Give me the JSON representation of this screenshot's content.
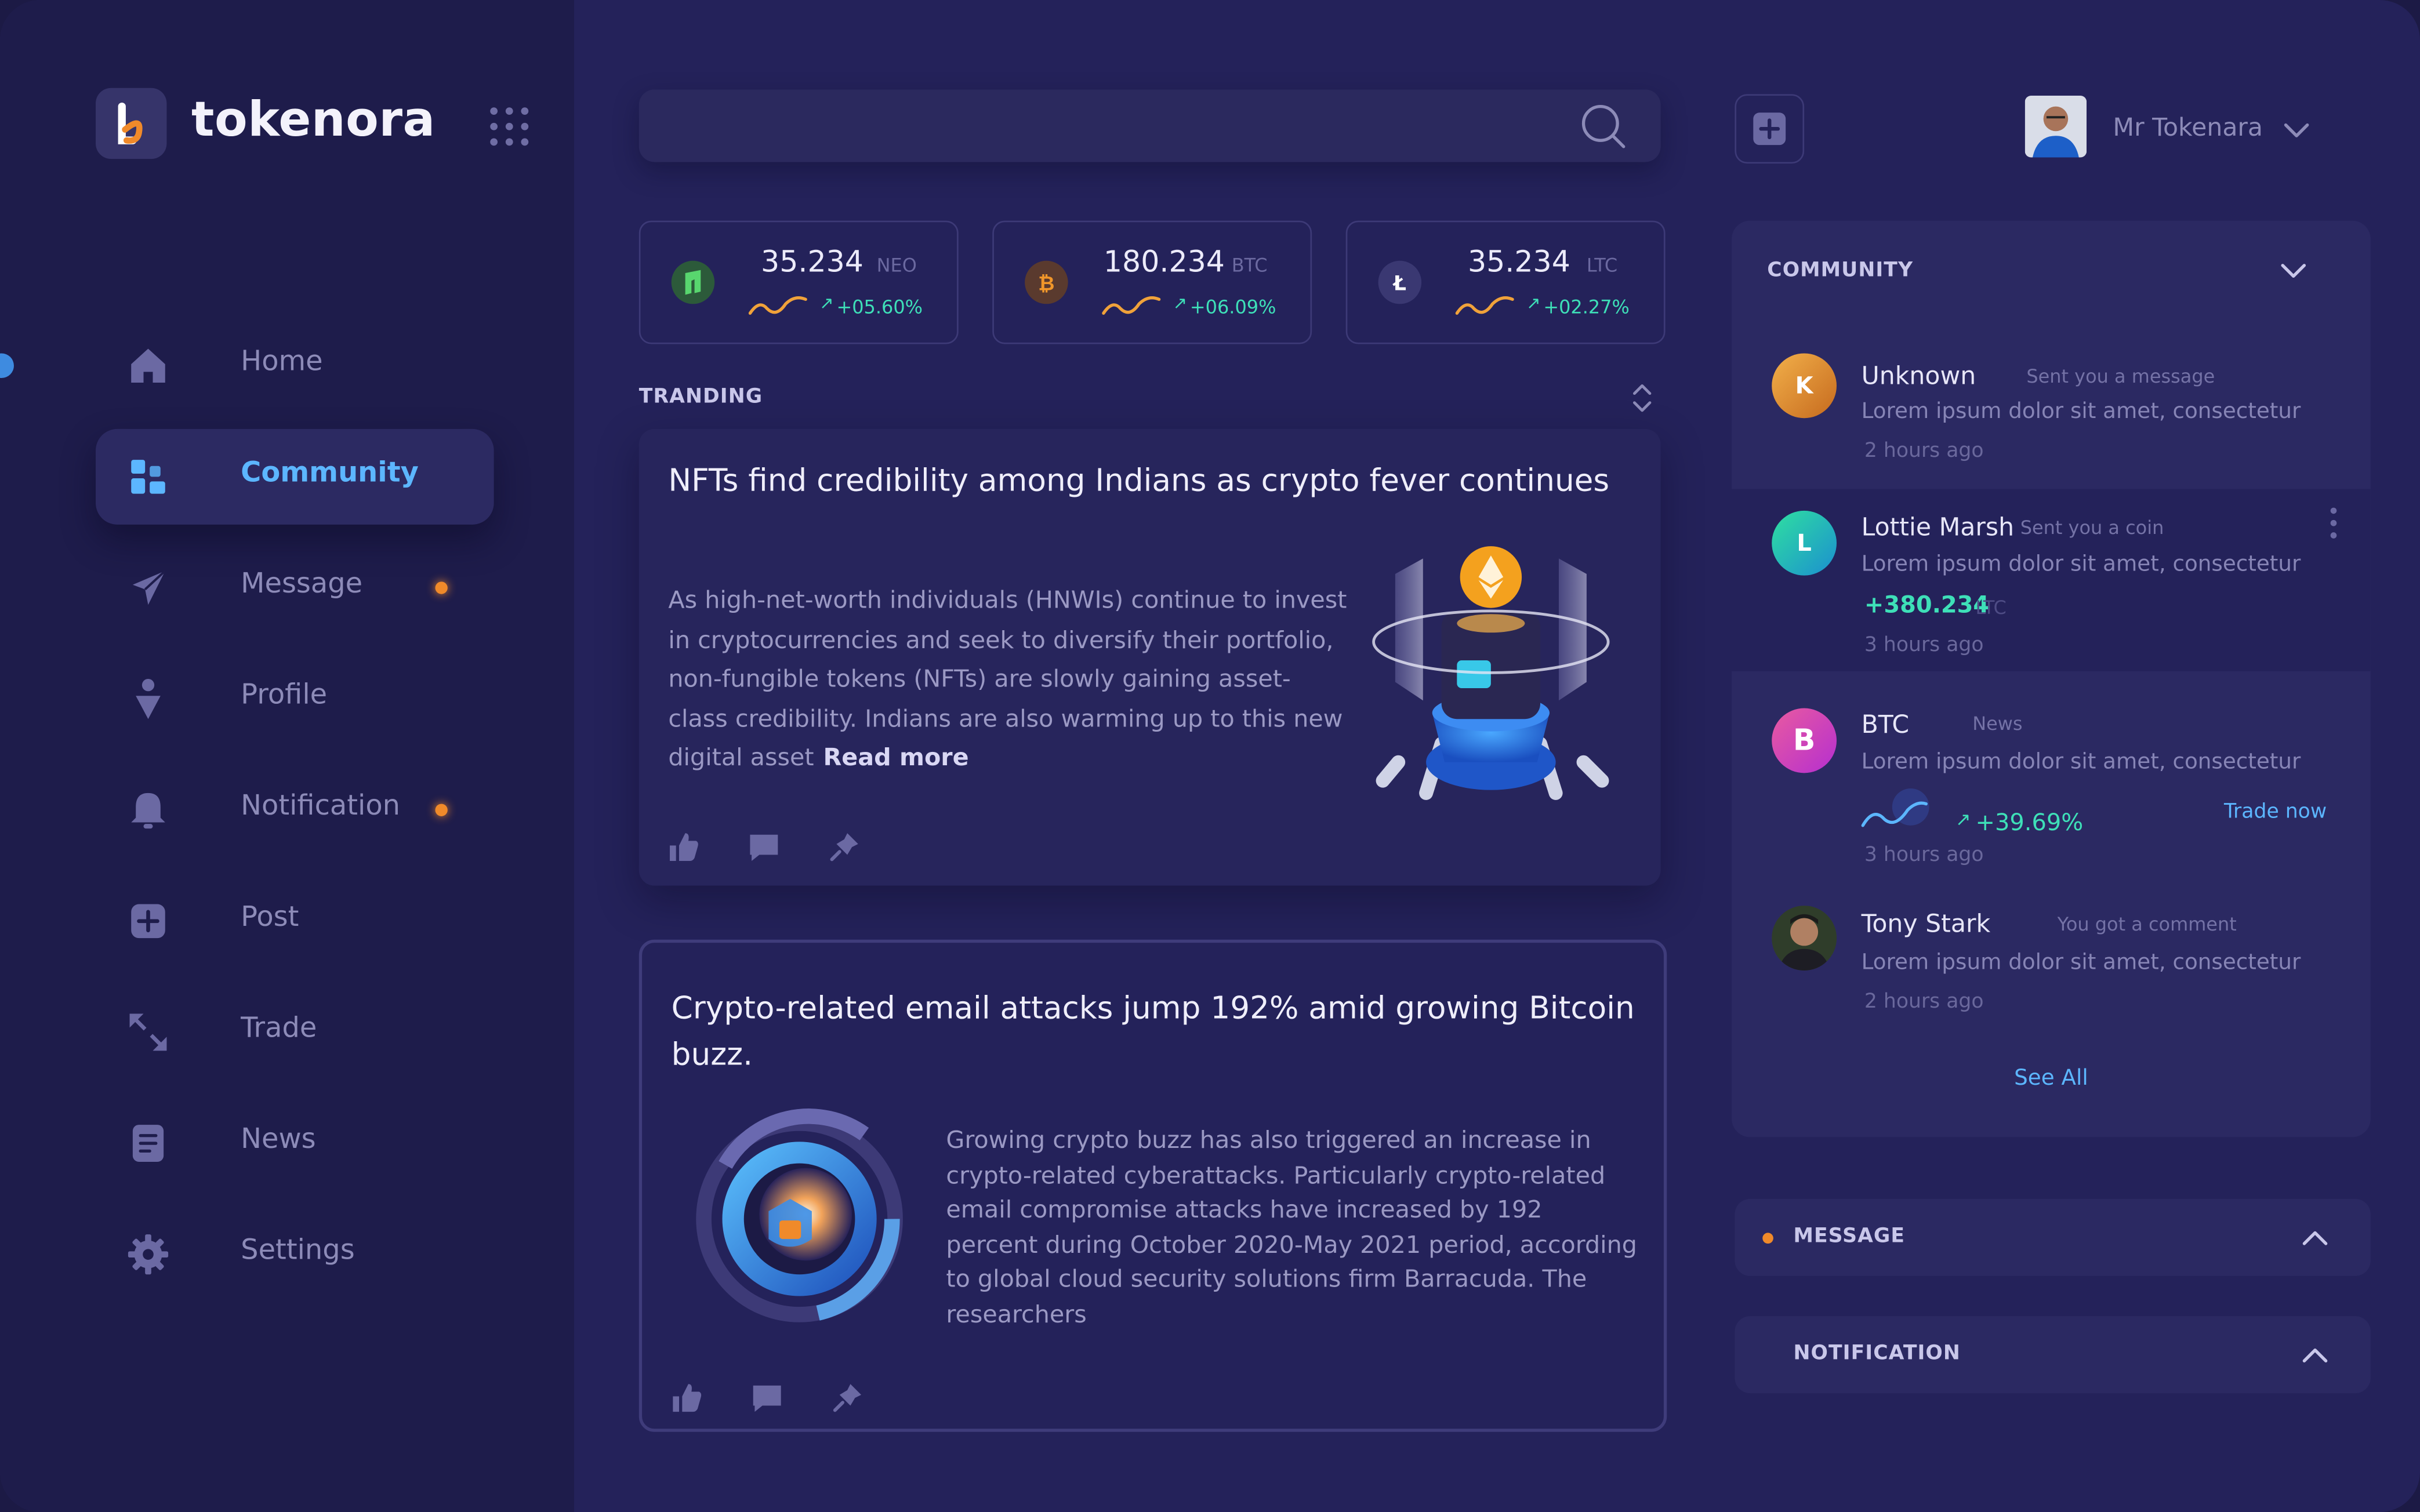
{
  "app": {
    "name": "tokenora"
  },
  "nav": [
    {
      "label": "Home",
      "icon": "home-icon",
      "active": false,
      "badge": false
    },
    {
      "label": "Community",
      "icon": "community-icon",
      "active": true,
      "badge": false
    },
    {
      "label": "Message",
      "icon": "send-icon",
      "active": false,
      "badge": true
    },
    {
      "label": "Profile",
      "icon": "profile-icon",
      "active": false,
      "badge": false
    },
    {
      "label": "Notification",
      "icon": "bell-icon",
      "active": false,
      "badge": true
    },
    {
      "label": "Post",
      "icon": "plus-square-icon",
      "active": false,
      "badge": false
    },
    {
      "label": "Trade",
      "icon": "trade-arrows-icon",
      "active": false,
      "badge": false
    },
    {
      "label": "News",
      "icon": "news-icon",
      "active": false,
      "badge": false
    },
    {
      "label": "Settings",
      "icon": "gear-icon",
      "active": false,
      "badge": false
    }
  ],
  "search": {
    "value": "",
    "placeholder": ""
  },
  "coins": [
    {
      "value": "35.234",
      "symbol": "NEO",
      "change": "+05.60%",
      "color": "#2c7a3a"
    },
    {
      "value": "180.234",
      "symbol": "BTC",
      "change": "+06.09%",
      "color": "#c8731d"
    },
    {
      "value": "35.234",
      "symbol": "LTC",
      "change": "+02.27%",
      "color": "#3a3872"
    }
  ],
  "trending": {
    "label": "TRANDING"
  },
  "articles": [
    {
      "title": "NFTs find credibility among Indians as crypto fever continues",
      "body": "As high-net-worth individuals (HNWIs) continue to invest in cryptocurrencies and seek to diversify their portfolio, non-fungible tokens (NFTs) are slowly gaining asset-class credibility. Indians are also warming up to this new digital asset",
      "read_more": "Read more"
    },
    {
      "title": "Crypto-related email attacks jump 192% amid growing Bitcoin buzz.",
      "body": "Growing crypto buzz has also triggered an increase in crypto-related cyberattacks. Particularly crypto-related email compromise attacks have increased by 192 percent during October 2020-May 2021 period, according to global cloud security solutions firm Barracuda. The researchers"
    }
  ],
  "user": {
    "name": "Mr Tokenara"
  },
  "community": {
    "title": "COMMUNITY",
    "items": [
      {
        "initial": "K",
        "name": "Unknown",
        "tag": "Sent you a message",
        "text": "Lorem ipsum dolor sit amet, consectetur",
        "time": "2 hours ago"
      },
      {
        "initial": "L",
        "name": "Lottie Marsh",
        "tag": "Sent you a coin",
        "text": "Lorem ipsum dolor sit amet, consectetur",
        "amount": "+380.234",
        "amount_unit": "LTC",
        "time": "3 hours ago"
      },
      {
        "initial": "B",
        "name": "BTC",
        "tag": "News",
        "text": "Lorem ipsum dolor sit amet, consectetur",
        "change": "+39.69%",
        "action": "Trade now",
        "time": "3 hours ago"
      },
      {
        "initial": "",
        "name": "Tony Stark",
        "tag": "You got a comment",
        "text": "Lorem ipsum dolor sit amet, consectetur",
        "time": "2 hours ago"
      }
    ],
    "see_all": "See All"
  },
  "message_panel": {
    "title": "MESSAGE"
  },
  "notification_panel": {
    "title": "NOTIFICATION"
  },
  "colors": {
    "accent": "#5cb6ff",
    "positive": "#3ee0b8",
    "badge": "#f08a2a",
    "background": "#24225a",
    "sidebar": "#1e1c4b"
  }
}
